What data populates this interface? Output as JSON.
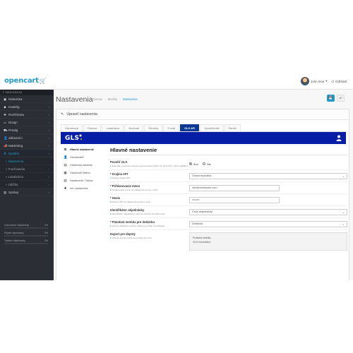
{
  "header": {
    "logo": "opencart",
    "logo_cart": "🛒",
    "user_name": "John Doe",
    "user_caret": "▾",
    "logout_label": "Odhlásiť",
    "logout_icon": "⏻"
  },
  "sidebar": {
    "title": "≡ NAVIGÁCIA",
    "items": [
      {
        "icon": "▣",
        "label": "Nástenka",
        "chevron": ""
      },
      {
        "icon": "◆",
        "label": "Katalóg",
        "chevron": "›"
      },
      {
        "icon": "✚",
        "label": "Rozšírenia",
        "chevron": "›"
      },
      {
        "icon": "▭",
        "label": "Dizajn",
        "chevron": "›"
      },
      {
        "icon": "⛟",
        "label": "Predaj",
        "chevron": "›"
      },
      {
        "icon": "👤",
        "label": "Zákazníci",
        "chevron": "›"
      },
      {
        "icon": "📣",
        "label": "Marketing",
        "chevron": "›"
      },
      {
        "icon": "⚙",
        "label": "Systém",
        "chevron": "›"
      }
    ],
    "submenu": [
      {
        "label": "» Nastavenia",
        "chevron": ""
      },
      {
        "label": "» Používatelia",
        "chevron": "›"
      },
      {
        "label": "» Lokalizácia",
        "chevron": "›"
      },
      {
        "label": "» Údržba",
        "chevron": "›"
      }
    ],
    "reports": {
      "icon": "▥",
      "label": "Správy",
      "chevron": "›"
    },
    "stats": [
      {
        "label": "Dokončené objednávky",
        "value": "0%",
        "fraction": 0.0
      },
      {
        "label": "Prijaté objednávky",
        "value": "0%",
        "fraction": 0.0
      },
      {
        "label": "Ostatné objednávky",
        "value": "0%",
        "fraction": 0.0
      }
    ]
  },
  "page": {
    "title": "Nastavenia",
    "breadcrumb": [
      "Domov",
      "Moduly",
      "Nastavenia"
    ],
    "breadcrumb_sep": "›",
    "save_icon": "💾",
    "back_icon": "↶"
  },
  "panel": {
    "heading_icon": "✎",
    "heading": "Upraviť nastavenia",
    "tabs": [
      "Všeobecné",
      "Obchod",
      "Lokalizácia",
      "Možnosti",
      "Obrázky",
      "E-mail",
      "GLS API",
      "Vyzdvihnutie",
      "Server"
    ],
    "active_tab": 6
  },
  "gls": {
    "logo": "GLS",
    "logo_dot": ".",
    "menu": [
      {
        "icon": "⚙",
        "label": "Hlavné nastavenie",
        "active": true
      },
      {
        "icon": "👤",
        "label": "Odosielateľ",
        "active": false
      },
      {
        "icon": "▤",
        "label": "Vlastnosti zásielok",
        "active": false
      },
      {
        "icon": "▦",
        "label": "Vlastnosti štítkov",
        "active": false
      },
      {
        "icon": "▤",
        "label": "Nastavenie Tlačiac",
        "active": false
      },
      {
        "icon": "✚",
        "label": "Iné nastavenia",
        "active": false
      }
    ]
  },
  "form": {
    "title": "Hlavné nastavenie",
    "help_icon": "ℹ",
    "rows": {
      "enable": {
        "label": "Povoliť GLS",
        "help": "Zapnutie / vypnutie modulu a generovania štítkov do GLS API / online aplikácie.",
        "yes": "Áno",
        "no": "Nie",
        "selected": "Áno"
      },
      "country": {
        "label": "* Krajina API",
        "help": "Vyberte krajinu API.",
        "value": "Česká republika",
        "caret": "⌄"
      },
      "login": {
        "label": "* Prihlasovacie meno",
        "help": "Prihlasovacie meno na zákaznícke konto v GLS.",
        "value": "info@mediaweb.com"
      },
      "password": {
        "label": "* Heslo",
        "help": "Heslo k API na zákaznícke konto v GLS.",
        "value": "••••••••"
      },
      "order_id": {
        "label": "Identifikátor objednávky",
        "help": "Identifikátor objednávky, ktorý sa zobrazí na štítku GLS.",
        "value": "Číslo objednávky",
        "caret": "⌄"
      },
      "payment": {
        "label": "* Platobná metóda pre dobierku",
        "help": "Vyberte platobnú metódu, ktorá sa použije na dobierku.",
        "value": "Dobierka",
        "caret": "⌄"
      },
      "depot": {
        "label": "Export pre depoty",
        "help": "Vyberte depoty, ktoré sa použijú pre GLS.",
        "options": [
          "Pražská satelita",
          "GLS Kancelária"
        ]
      }
    }
  }
}
